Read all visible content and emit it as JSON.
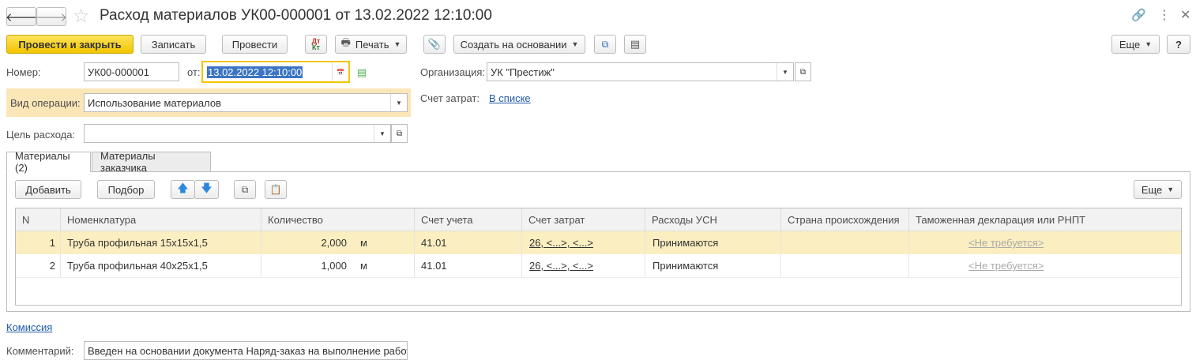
{
  "window": {
    "title": "Расход материалов УК00-000001 от 13.02.2022 12:10:00"
  },
  "toolbar": {
    "post_close": "Провести и закрыть",
    "save": "Записать",
    "post": "Провести",
    "print": "Печать",
    "create_based": "Создать на основании",
    "more": "Еще",
    "help": "?"
  },
  "form": {
    "number_label": "Номер:",
    "number_value": "УК00-000001",
    "date_label": "от:",
    "date_value": "13.02.2022 12:10:00",
    "org_label": "Организация:",
    "org_value": "УК \"Престиж\"",
    "optype_label": "Вид операции:",
    "optype_value": "Использование материалов",
    "cost_account_label": "Счет затрат:",
    "cost_account_link": "В списке",
    "purpose_label": "Цель расхода:",
    "purpose_value": ""
  },
  "tabs": [
    {
      "label": "Материалы (2)",
      "active": true
    },
    {
      "label": "Материалы заказчика",
      "active": false
    }
  ],
  "table_toolbar": {
    "add": "Добавить",
    "pick": "Подбор",
    "more": "Еще"
  },
  "table": {
    "columns": [
      "N",
      "Номенклатура",
      "Количество",
      "Счет учета",
      "Счет затрат",
      "Расходы УСН",
      "Страна происхождения",
      "Таможенная декларация или РНПТ"
    ],
    "rows": [
      {
        "n": "1",
        "item": "Труба профильная 15х15х1,5",
        "qty": "2,000",
        "unit": "м",
        "account": "41.01",
        "cost": "26, <...>, <...>",
        "usn": "Принимаются",
        "country": "",
        "customs": "<Не требуется>"
      },
      {
        "n": "2",
        "item": "Труба профильная 40х25х1,5",
        "qty": "1,000",
        "unit": "м",
        "account": "41.01",
        "cost": "26, <...>, <...>",
        "usn": "Принимаются",
        "country": "",
        "customs": "<Не требуется>"
      }
    ]
  },
  "footer": {
    "commission_link": "Комиссия",
    "comment_label": "Комментарий:",
    "comment_value": "Введен на основании документа Наряд-заказ на выполнение работ"
  },
  "colors": {
    "primary": "#f2c500",
    "highlight_row": "#fbeec0",
    "optype_bg": "#fbe6b8",
    "link": "#1f5aa6"
  }
}
